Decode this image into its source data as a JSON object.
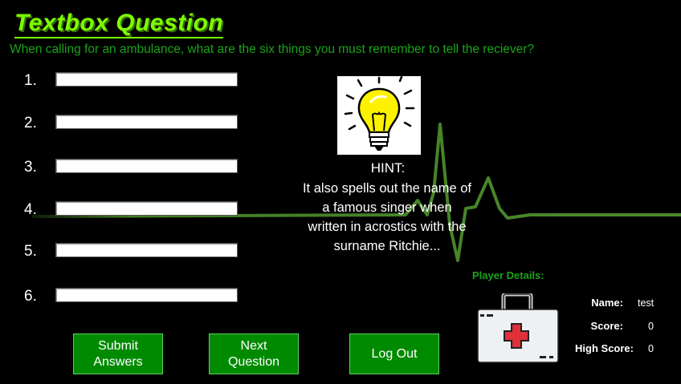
{
  "header": {
    "title": "Textbox Question",
    "question": "When calling for an ambulance, what are the six things you must remember to tell the reciever?"
  },
  "answers": [
    {
      "number": "1.",
      "value": ""
    },
    {
      "number": "2.",
      "value": ""
    },
    {
      "number": "3.",
      "value": ""
    },
    {
      "number": "4.",
      "value": ""
    },
    {
      "number": "5.",
      "value": ""
    },
    {
      "number": "6.",
      "value": ""
    }
  ],
  "hint": {
    "title": "HINT:",
    "text": "It also spells out the name of a famous singer when written in acrostics with the surname Ritchie...",
    "icon": "lightbulb-icon"
  },
  "buttons": {
    "submit": "Submit Answers",
    "next": "Next Question",
    "logout": "Log Out"
  },
  "player": {
    "title": "Player Details:",
    "name_label": "Name:",
    "name": "test",
    "score_label": "Score:",
    "score": "0",
    "high_score_label": "High Score:",
    "high_score": "0",
    "icon": "first-aid-kit-icon"
  },
  "colors": {
    "accent": "#7cfc00",
    "question": "#19a319",
    "button": "#008a00",
    "ecg": "#4a8a2a"
  }
}
